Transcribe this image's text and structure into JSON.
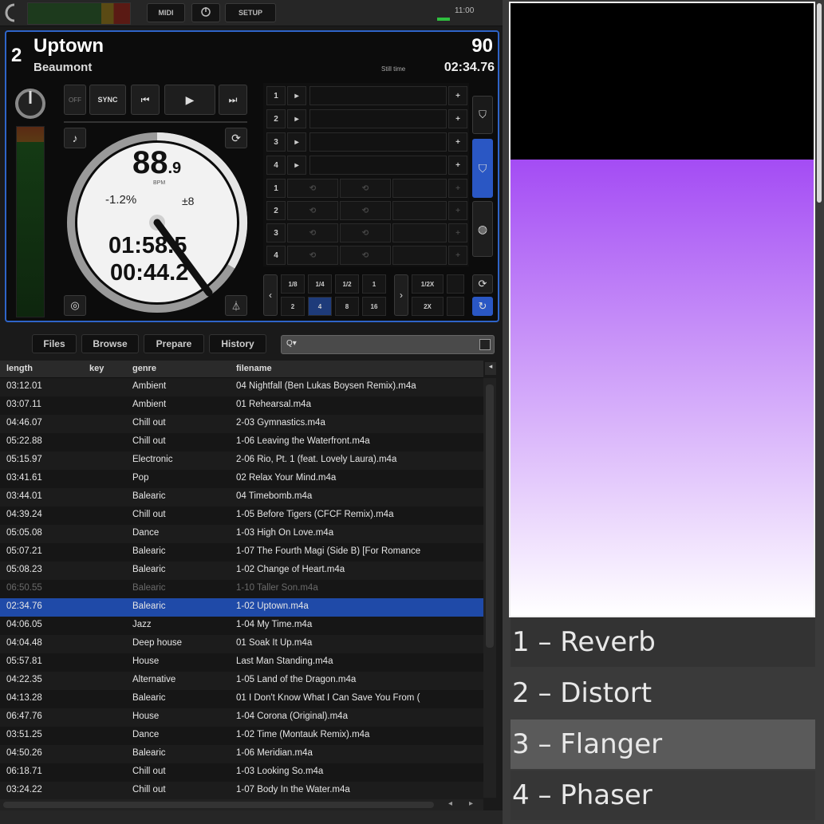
{
  "topbar": {
    "midi_label": "MIDI",
    "setup_label": "SETUP",
    "clock": "11:00",
    "colors": {
      "meter_green": "#1d3a1d",
      "meter_red": "#5a1a14"
    }
  },
  "deck": {
    "number": "2",
    "title": "Uptown",
    "artist": "Beaumont",
    "bpm_top": "90",
    "time_label": "Still time",
    "time_total": "02:34.76",
    "sync_label": "SYNC",
    "off_label": "OFF",
    "bpm_main": "88",
    "bpm_decimal": ".9",
    "bpm_unit": "BPM",
    "pitch": "-1.2%",
    "pitch_range": "±8",
    "elapsed": "01:58.5",
    "remaining": "00:44.2",
    "colors": {
      "border": "#2e64c8",
      "selected_pad": "#1e3b7a"
    }
  },
  "cue_pads": [
    "1",
    "2",
    "3",
    "4"
  ],
  "loop_pads": [
    "1",
    "2",
    "3",
    "4"
  ],
  "loop_sizes_top": [
    "1/8",
    "1/4",
    "1/2",
    "1"
  ],
  "loop_sizes_bottom": [
    "2",
    "4",
    "8",
    "16"
  ],
  "loop_right_top": "1/2X",
  "loop_right_bottom": "2X",
  "browser": {
    "tabs": [
      "Files",
      "Browse",
      "Prepare",
      "History"
    ],
    "search_placeholder": "Q▾",
    "columns": [
      "length",
      "key",
      "genre",
      "filename"
    ]
  },
  "tracks": [
    {
      "length": "03:12.01",
      "key": "",
      "genre": "Ambient",
      "filename": "04 Nightfall (Ben Lukas Boysen Remix).m4a"
    },
    {
      "length": "03:07.11",
      "key": "",
      "genre": "Ambient",
      "filename": "01 Rehearsal.m4a"
    },
    {
      "length": "04:46.07",
      "key": "",
      "genre": "Chill out",
      "filename": "2-03 Gymnastics.m4a"
    },
    {
      "length": "05:22.88",
      "key": "",
      "genre": "Chill out",
      "filename": "1-06 Leaving the Waterfront.m4a"
    },
    {
      "length": "05:15.97",
      "key": "",
      "genre": "Electronic",
      "filename": "2-06 Rio, Pt. 1 (feat. Lovely Laura).m4a"
    },
    {
      "length": "03:41.61",
      "key": "",
      "genre": "Pop",
      "filename": "02 Relax Your Mind.m4a"
    },
    {
      "length": "03:44.01",
      "key": "",
      "genre": "Balearic",
      "filename": "04 Timebomb.m4a"
    },
    {
      "length": "04:39.24",
      "key": "",
      "genre": "Chill out",
      "filename": "1-05 Before Tigers (CFCF Remix).m4a"
    },
    {
      "length": "05:05.08",
      "key": "",
      "genre": "Dance",
      "filename": "1-03 High On Love.m4a"
    },
    {
      "length": "05:07.21",
      "key": "",
      "genre": "Balearic",
      "filename": "1-07 The Fourth Magi (Side B) [For Romance"
    },
    {
      "length": "05:08.23",
      "key": "",
      "genre": "Balearic",
      "filename": "1-02 Change of Heart.m4a"
    },
    {
      "length": "06:50.55",
      "key": "",
      "genre": "Balearic",
      "filename": "1-10 Taller Son.m4a",
      "dim": true
    },
    {
      "length": "02:34.76",
      "key": "",
      "genre": "Balearic",
      "filename": "1-02 Uptown.m4a",
      "selected": true
    },
    {
      "length": "04:06.05",
      "key": "",
      "genre": "Jazz",
      "filename": "1-04 My Time.m4a"
    },
    {
      "length": "04:04.48",
      "key": "",
      "genre": "Deep house",
      "filename": "01 Soak It Up.m4a"
    },
    {
      "length": "05:57.81",
      "key": "",
      "genre": "House",
      "filename": "Last Man Standing.m4a"
    },
    {
      "length": "04:22.35",
      "key": "",
      "genre": "Alternative",
      "filename": "1-05 Land of the Dragon.m4a"
    },
    {
      "length": "04:13.28",
      "key": "",
      "genre": "Balearic",
      "filename": "01 I Don't Know What I Can Save You From ("
    },
    {
      "length": "06:47.76",
      "key": "",
      "genre": "House",
      "filename": "1-04 Corona (Original).m4a"
    },
    {
      "length": "03:51.25",
      "key": "",
      "genre": "Dance",
      "filename": "1-02 Time (Montauk Remix).m4a"
    },
    {
      "length": "04:50.26",
      "key": "",
      "genre": "Balearic",
      "filename": "1-06 Meridian.m4a"
    },
    {
      "length": "06:18.71",
      "key": "",
      "genre": "Chill out",
      "filename": "1-03 Looking So.m4a"
    },
    {
      "length": "03:24.22",
      "key": "",
      "genre": "Chill out",
      "filename": "1-07 Body In the Water.m4a"
    }
  ],
  "effects": {
    "gradient_top": "#a44cf4",
    "gradient_bottom": "#ffffff",
    "items": [
      {
        "label": "1 – Reverb",
        "selected": false
      },
      {
        "label": "2 – Distort",
        "selected": false
      },
      {
        "label": "3 – Flanger",
        "selected": true
      },
      {
        "label": "4 – Phaser",
        "selected": false
      }
    ]
  }
}
